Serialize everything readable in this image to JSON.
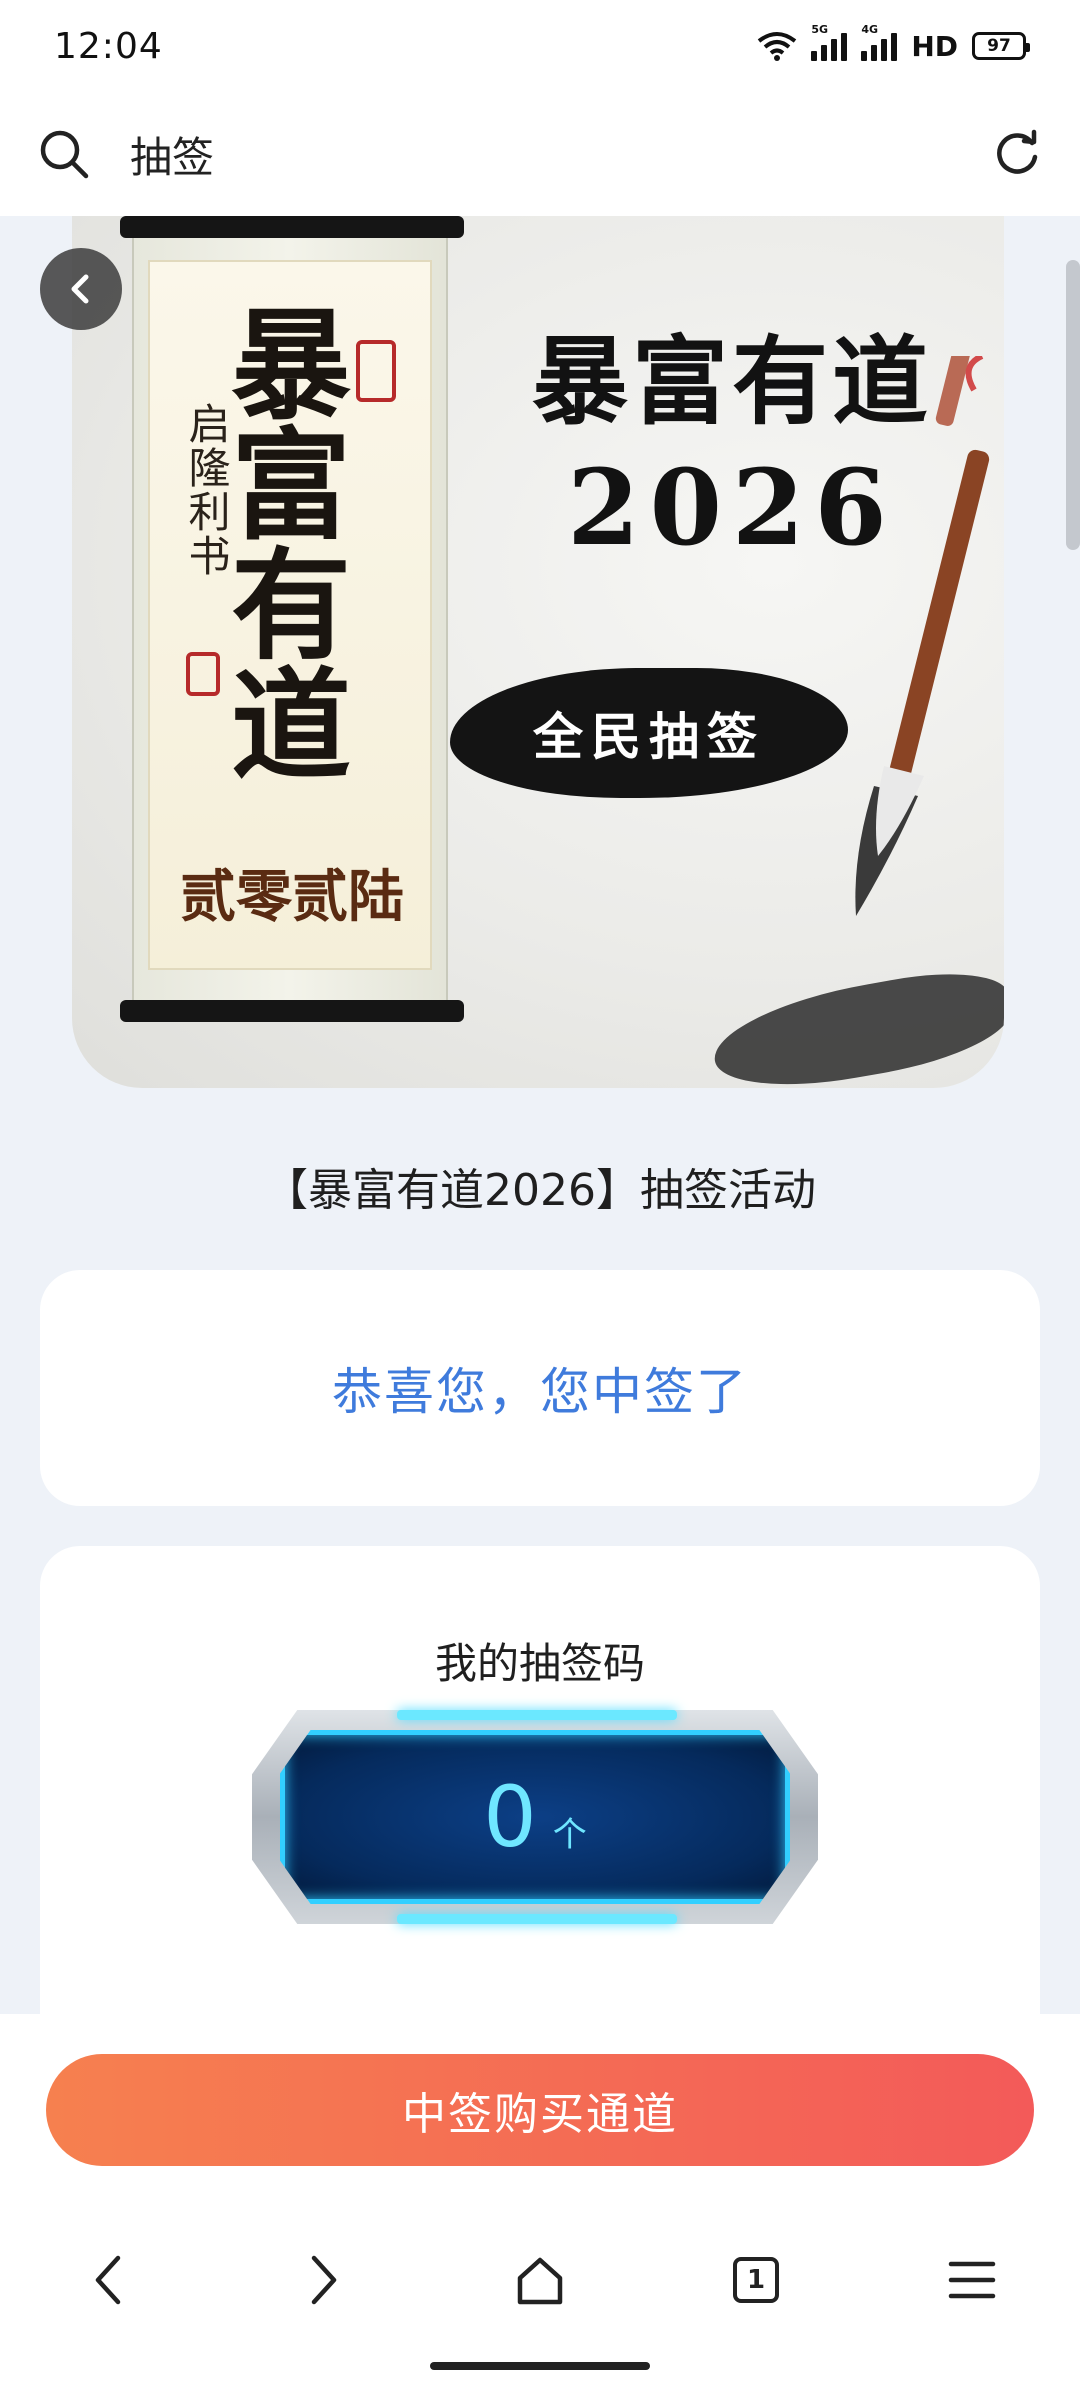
{
  "status_bar": {
    "time": "12:04",
    "net_tag_1": "5G",
    "net_tag_2": "4G",
    "hd_label": "HD",
    "battery": "97"
  },
  "search_bar": {
    "query": "抽签",
    "icons": [
      "search-icon",
      "refresh-icon"
    ]
  },
  "banner": {
    "title": "暴富有道",
    "year": "2026",
    "badge": "全民抽签",
    "scroll_main": "暴富有道",
    "scroll_side": "启隆利书",
    "scroll_year": "贰零贰陆"
  },
  "activity_title": "【暴富有道2026】抽签活动",
  "result_text": "恭喜您，您中签了",
  "code_section": {
    "label": "我的抽签码",
    "count": "0",
    "unit": "个"
  },
  "buy_button": "中签购买通道",
  "bottom_nav": {
    "tab_count": "1",
    "icons": [
      "back-icon",
      "forward-icon",
      "home-icon",
      "tabs-icon",
      "menu-icon"
    ]
  },
  "colors": {
    "accent_blue": "#3f7bdc",
    "button_start": "#f6804f",
    "button_end": "#f35a59",
    "gauge_cyan": "#6fe6ff"
  }
}
